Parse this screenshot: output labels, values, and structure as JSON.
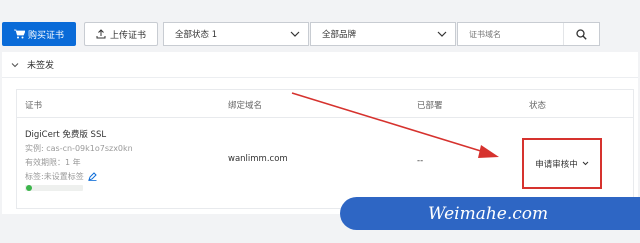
{
  "toolbar": {
    "buy_label": "购买证书",
    "upload_label": "上传证书",
    "status_select": "全部状态 1",
    "brand_select": "全部品牌",
    "search_placeholder": "证书域名"
  },
  "group": {
    "title": "未签发"
  },
  "table": {
    "headers": [
      "证书",
      "绑定域名",
      "已部署",
      "状态"
    ]
  },
  "cert": {
    "name": "DigiCert 免费版 SSL",
    "instance": "实例: cas-cn-09k1o7szx0kn",
    "valid": "有效期限：1 年",
    "tag": "标签:未设置标签",
    "domain": "wanlimm.com",
    "deployed": "--",
    "status": "申请审核中"
  },
  "watermark": {
    "text": "Weimahe.com"
  },
  "colors": {
    "primary": "#0a6bd8",
    "highlight": "#d6322e",
    "watermark_bg": "#2e66c4"
  }
}
